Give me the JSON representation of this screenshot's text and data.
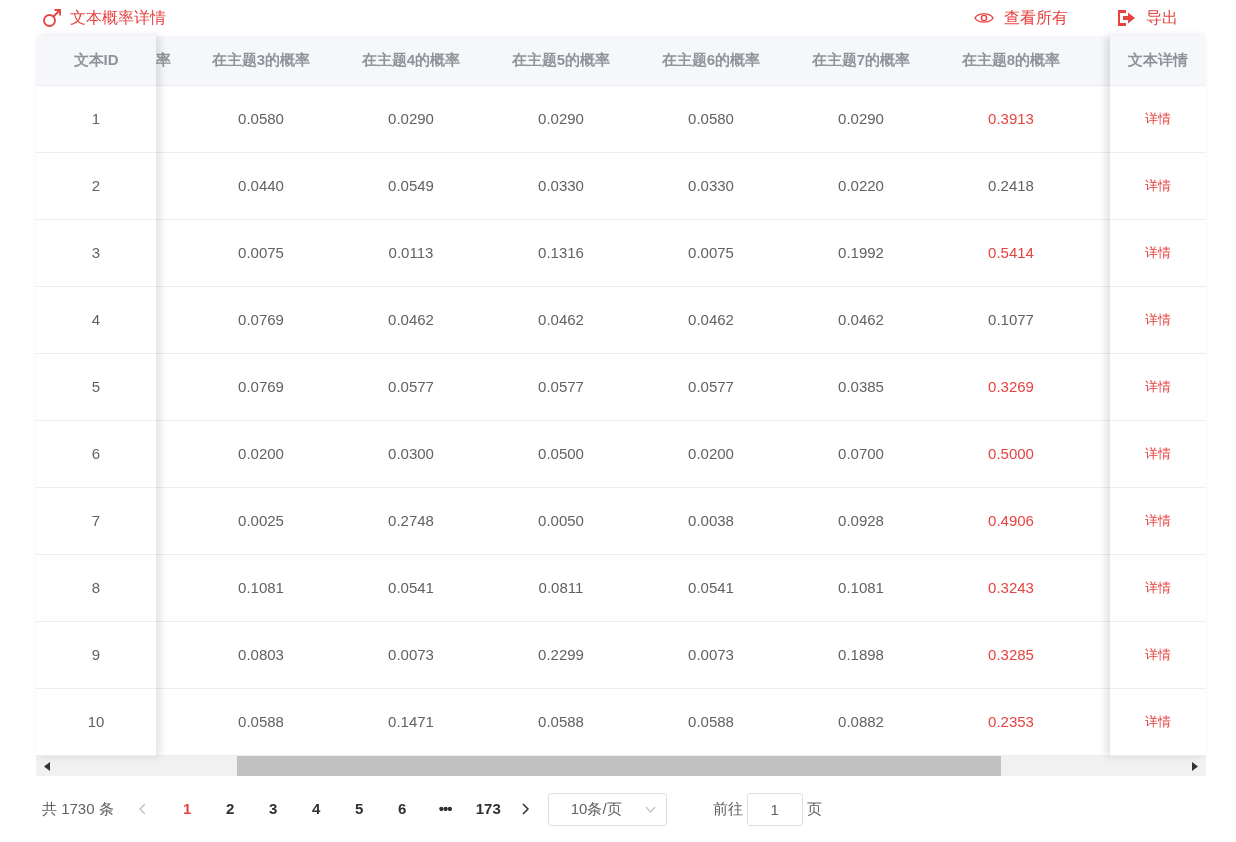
{
  "title": "文本概率详情",
  "actions": [
    {
      "kind": "view",
      "label": "查看所有"
    },
    {
      "kind": "export",
      "label": "导出"
    }
  ],
  "table": {
    "id_column": "文本ID",
    "partial_column": "率",
    "columns": [
      "在主题3的概率",
      "在主题4的概率",
      "在主题5的概率",
      "在主题6的概率",
      "在主题7的概率",
      "在主题8的概率"
    ],
    "detail_column": "文本详情",
    "rows": [
      {
        "id": "1",
        "cells": [
          "0.0580",
          "0.0290",
          "0.0290",
          "0.0580",
          "0.0290"
        ],
        "last": {
          "value": "0.3913",
          "highlight": true
        },
        "action": "详情"
      },
      {
        "id": "2",
        "cells": [
          "0.0440",
          "0.0549",
          "0.0330",
          "0.0330",
          "0.0220"
        ],
        "last": {
          "value": "0.2418",
          "highlight": false
        },
        "action": "详情"
      },
      {
        "id": "3",
        "cells": [
          "0.0075",
          "0.0113",
          "0.1316",
          "0.0075",
          "0.1992"
        ],
        "last": {
          "value": "0.5414",
          "highlight": true
        },
        "action": "详情"
      },
      {
        "id": "4",
        "cells": [
          "0.0769",
          "0.0462",
          "0.0462",
          "0.0462",
          "0.0462"
        ],
        "last": {
          "value": "0.1077",
          "highlight": false
        },
        "action": "详情"
      },
      {
        "id": "5",
        "cells": [
          "0.0769",
          "0.0577",
          "0.0577",
          "0.0577",
          "0.0385"
        ],
        "last": {
          "value": "0.3269",
          "highlight": true
        },
        "action": "详情"
      },
      {
        "id": "6",
        "cells": [
          "0.0200",
          "0.0300",
          "0.0500",
          "0.0200",
          "0.0700"
        ],
        "last": {
          "value": "0.5000",
          "highlight": true
        },
        "action": "详情"
      },
      {
        "id": "7",
        "cells": [
          "0.0025",
          "0.2748",
          "0.0050",
          "0.0038",
          "0.0928"
        ],
        "last": {
          "value": "0.4906",
          "highlight": true
        },
        "action": "详情"
      },
      {
        "id": "8",
        "cells": [
          "0.1081",
          "0.0541",
          "0.0811",
          "0.0541",
          "0.1081"
        ],
        "last": {
          "value": "0.3243",
          "highlight": true
        },
        "action": "详情"
      },
      {
        "id": "9",
        "cells": [
          "0.0803",
          "0.0073",
          "0.2299",
          "0.0073",
          "0.1898"
        ],
        "last": {
          "value": "0.3285",
          "highlight": true
        },
        "action": "详情"
      },
      {
        "id": "10",
        "cells": [
          "0.0588",
          "0.1471",
          "0.0588",
          "0.0588",
          "0.0882"
        ],
        "last": {
          "value": "0.2353",
          "highlight": true
        },
        "action": "详情"
      }
    ]
  },
  "pagination": {
    "total": "共 1730 条",
    "pages": [
      {
        "label": "1",
        "selected": true,
        "kind": "page"
      },
      {
        "label": "2",
        "selected": false,
        "kind": "page"
      },
      {
        "label": "3",
        "selected": false,
        "kind": "page"
      },
      {
        "label": "4",
        "selected": false,
        "kind": "page"
      },
      {
        "label": "5",
        "selected": false,
        "kind": "page"
      },
      {
        "label": "6",
        "selected": false,
        "kind": "page"
      },
      {
        "label": "•••",
        "selected": false,
        "kind": "more"
      },
      {
        "label": "173",
        "selected": false,
        "kind": "page"
      }
    ],
    "page_size": "10条/页",
    "goto_label": "前往",
    "goto_value": "1",
    "goto_suffix": "页"
  }
}
